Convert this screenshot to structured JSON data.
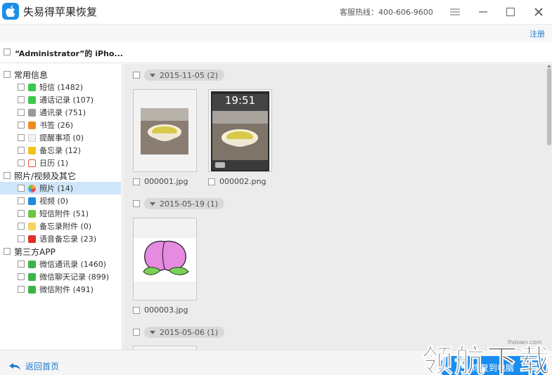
{
  "app": {
    "title": "失易得苹果恢复",
    "hotline": "客服热线：400-606-9600",
    "register": "注册"
  },
  "device": {
    "title": "“Administrator”的 iPho..."
  },
  "sidebar": {
    "categories": [
      {
        "label": "常用信息",
        "items": [
          {
            "label": "短信 (1482)",
            "icon": "sms-icon",
            "color": "#3cc84b"
          },
          {
            "label": "通话记录 (107)",
            "icon": "phone-icon",
            "color": "#3cc84b"
          },
          {
            "label": "通讯录 (751)",
            "icon": "contacts-icon",
            "color": "#9a9a9a"
          },
          {
            "label": "书签 (26)",
            "icon": "bookmark-icon",
            "color": "#f08a1c"
          },
          {
            "label": "提醒事项 (0)",
            "icon": "reminder-icon",
            "color": "#d8d8d8"
          },
          {
            "label": "备忘录 (12)",
            "icon": "notes-icon",
            "color": "#f0c419"
          },
          {
            "label": "日历 (1)",
            "icon": "calendar-icon",
            "color": "#e84a3c"
          }
        ]
      },
      {
        "label": "照片/视频及其它",
        "items": [
          {
            "label": "照片 (14)",
            "icon": "photos-icon",
            "color": "#f2a33a",
            "selected": true
          },
          {
            "label": "视频 (0)",
            "icon": "video-icon",
            "color": "#1f8ad9"
          },
          {
            "label": "短信附件 (51)",
            "icon": "attachment-icon",
            "color": "#6cc63f"
          },
          {
            "label": "备忘录附件 (0)",
            "icon": "notes-attachment-icon",
            "color": "#f6d35a"
          },
          {
            "label": "语音备忘录 (23)",
            "icon": "voice-memo-icon",
            "color": "#e0312b"
          }
        ]
      },
      {
        "label": "第三方APP",
        "items": [
          {
            "label": "微信通讯录 (1460)",
            "icon": "wechat-contacts-icon",
            "color": "#3cb449"
          },
          {
            "label": "微信聊天记录 (899)",
            "icon": "wechat-chat-icon",
            "color": "#3cb449"
          },
          {
            "label": "微信附件 (491)",
            "icon": "wechat-attachment-icon",
            "color": "#3cb449"
          }
        ]
      }
    ]
  },
  "main": {
    "groups": [
      {
        "date": "2015-11-05 (2)",
        "files": [
          "000001.jpg",
          "000002.png"
        ]
      },
      {
        "date": "2015-05-19 (1)",
        "files": [
          "000003.jpg"
        ]
      },
      {
        "date": "2015-05-06 (1)",
        "files": []
      }
    ],
    "lock_time": "19:51"
  },
  "footer": {
    "back_label": "返回首页",
    "recover_label": "恢复到电脑"
  },
  "watermark": {
    "url": "lhdown.com",
    "text": "领航下载"
  },
  "colors": {
    "accent": "#1a8df0",
    "selected_bg": "#cfe6fa"
  }
}
